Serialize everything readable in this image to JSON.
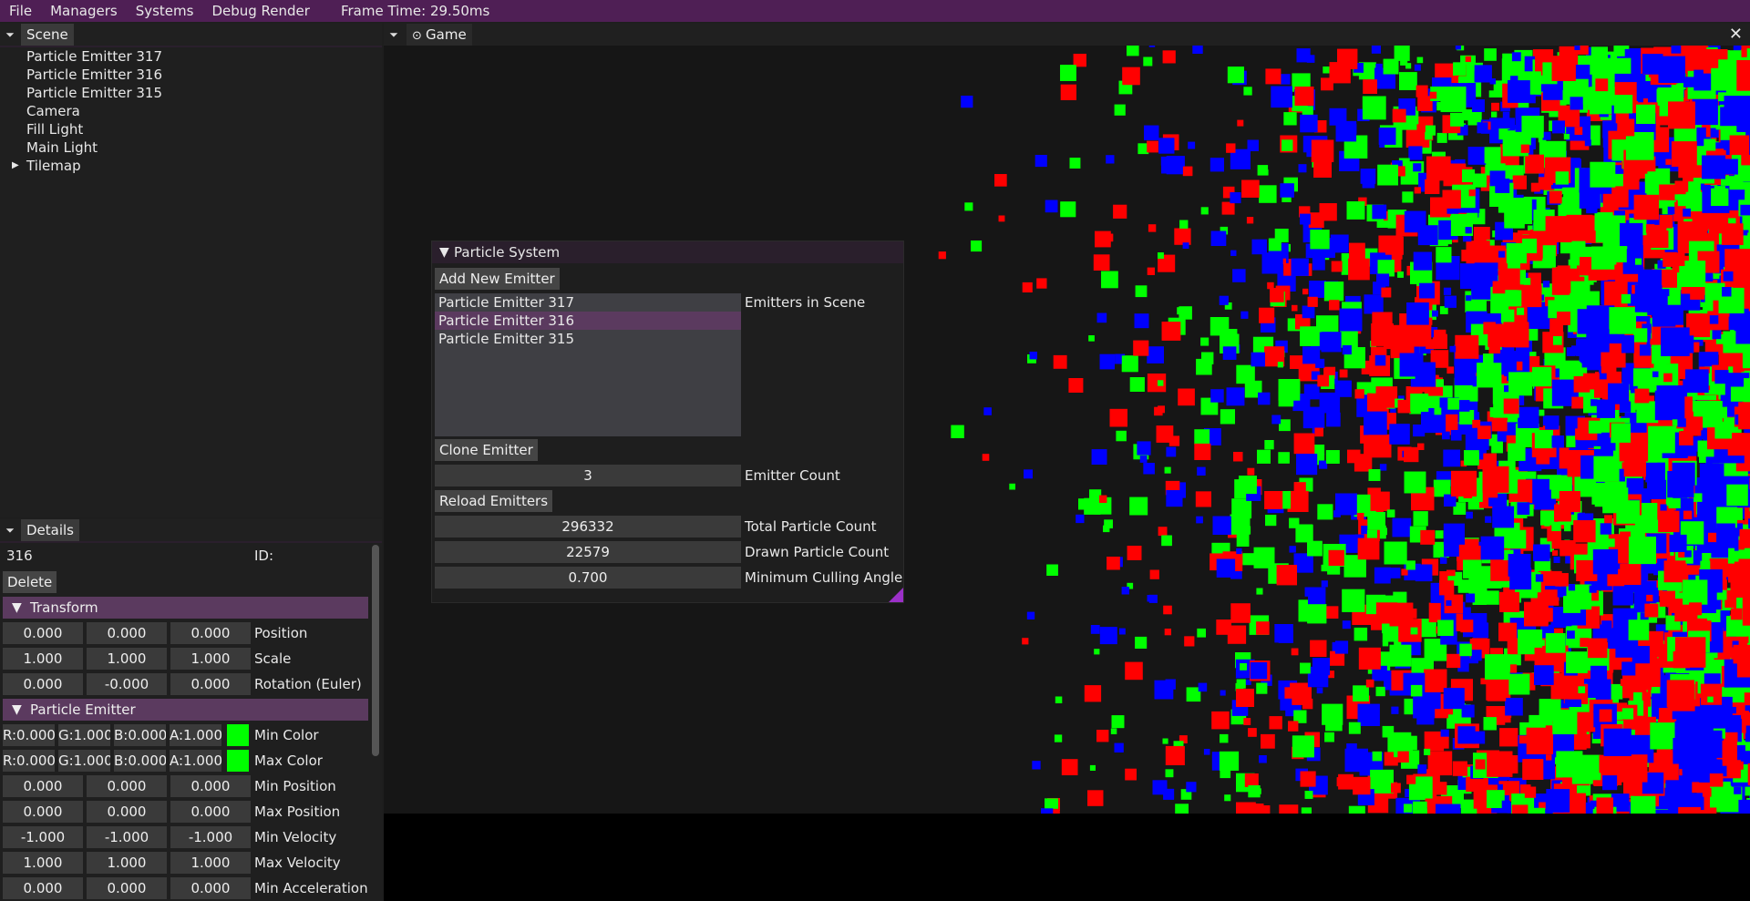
{
  "menu": {
    "items": [
      "File",
      "Managers",
      "Systems",
      "Debug Render"
    ],
    "frame_time": "Frame Time: 29.50ms"
  },
  "scene": {
    "tab": "Scene",
    "items": [
      {
        "label": "Particle Emitter 317",
        "expandable": false
      },
      {
        "label": "Particle Emitter 316",
        "expandable": false
      },
      {
        "label": "Particle Emitter 315",
        "expandable": false
      },
      {
        "label": "Camera",
        "expandable": false
      },
      {
        "label": "Fill Light",
        "expandable": false
      },
      {
        "label": "Main Light",
        "expandable": false
      },
      {
        "label": "Tilemap",
        "expandable": true
      }
    ]
  },
  "details": {
    "tab": "Details",
    "id_value": "316",
    "id_label": "ID:",
    "delete_label": "Delete",
    "transform": {
      "header": "Transform",
      "rows": [
        {
          "values": [
            "0.000",
            "0.000",
            "0.000"
          ],
          "label": "Position"
        },
        {
          "values": [
            "1.000",
            "1.000",
            "1.000"
          ],
          "label": "Scale"
        },
        {
          "values": [
            "0.000",
            "-0.000",
            "0.000"
          ],
          "label": "Rotation (Euler)"
        }
      ]
    },
    "emitter": {
      "header": "Particle Emitter",
      "color_rows": [
        {
          "values": [
            "R:0.000",
            "G:1.000",
            "B:0.000",
            "A:1.000"
          ],
          "swatch": "#00ff00",
          "label": "Min Color"
        },
        {
          "values": [
            "R:0.000",
            "G:1.000",
            "B:0.000",
            "A:1.000"
          ],
          "swatch": "#00ff00",
          "label": "Max Color"
        }
      ],
      "rows": [
        {
          "values": [
            "0.000",
            "0.000",
            "0.000"
          ],
          "label": "Min Position"
        },
        {
          "values": [
            "0.000",
            "0.000",
            "0.000"
          ],
          "label": "Max Position"
        },
        {
          "values": [
            "-1.000",
            "-1.000",
            "-1.000"
          ],
          "label": "Min Velocity"
        },
        {
          "values": [
            "1.000",
            "1.000",
            "1.000"
          ],
          "label": "Max Velocity"
        },
        {
          "values": [
            "0.000",
            "0.000",
            "0.000"
          ],
          "label": "Min Acceleration"
        }
      ]
    }
  },
  "game": {
    "tab": "Game",
    "close": "✕"
  },
  "particle_system": {
    "title": "Particle System",
    "add_new": "Add New Emitter",
    "emitters": [
      "Particle Emitter 317",
      "Particle Emitter 316",
      "Particle Emitter 315"
    ],
    "selected_index": 1,
    "emitters_label": "Emitters in Scene",
    "clone": "Clone Emitter",
    "emitter_count": "3",
    "emitter_count_label": "Emitter Count",
    "reload": "Reload Emitters",
    "total_particles": "296332",
    "total_label": "Total Particle Count",
    "drawn_particles": "22579",
    "drawn_label": "Drawn Particle Count",
    "culling_angle": "0.700",
    "culling_label": "Minimum Culling Angle"
  },
  "colors": {
    "accent": "#4f1f55",
    "selection": "#5b3a5f",
    "red": "#ff0000",
    "green": "#00ff00",
    "blue": "#0000ff"
  }
}
